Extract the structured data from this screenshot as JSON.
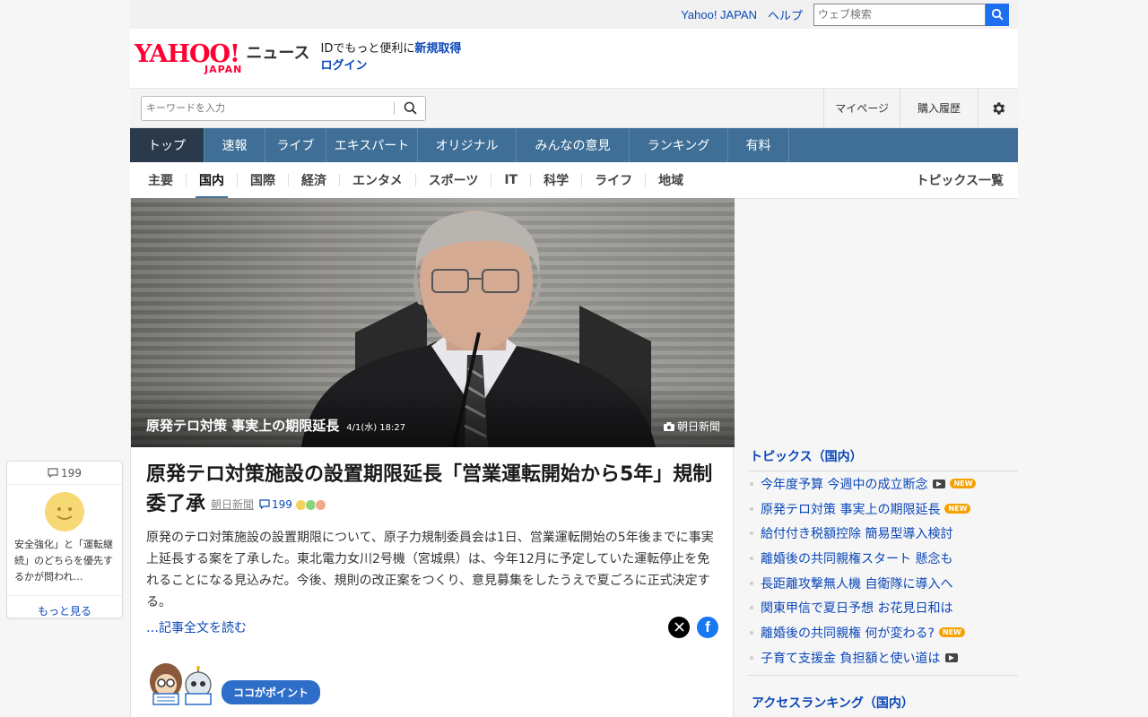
{
  "topbar": {
    "yahoo_link": "Yahoo! JAPAN",
    "help_link": "ヘルプ",
    "search_placeholder": "ウェブ検索"
  },
  "header": {
    "logo_text": "YAHOO!",
    "logo_sub": "JAPAN",
    "service": "ニュース",
    "id_prompt": "IDでもっと便利に",
    "signup": "新規取得",
    "login": "ログイン"
  },
  "search": {
    "placeholder": "キーワードを入力"
  },
  "user_links": {
    "mypage": "マイページ",
    "history": "購入履歴"
  },
  "nav": {
    "items": [
      {
        "label": "トップ",
        "w": 83
      },
      {
        "label": "速報",
        "w": 68
      },
      {
        "label": "ライブ",
        "w": 68
      },
      {
        "label": "エキスパート",
        "w": 102
      },
      {
        "label": "オリジナル",
        "w": 110
      },
      {
        "label": "みんなの意見",
        "w": 126
      },
      {
        "label": "ランキング",
        "w": 110
      },
      {
        "label": "有料",
        "w": 68
      }
    ]
  },
  "subnav": {
    "items": [
      "主要",
      "国内",
      "国際",
      "経済",
      "エンタメ",
      "スポーツ",
      "IT",
      "科学",
      "ライフ",
      "地域"
    ],
    "active": "国内",
    "all_topics": "トピックス一覧"
  },
  "hero": {
    "caption": "原発テロ対策 事実上の期限延長",
    "time": "4/1(水) 18:27",
    "source": "朝日新聞"
  },
  "article": {
    "title": "原発テロ対策施設の設置期限延長「営業運転開始から5年」規制委了承",
    "source": "朝日新聞",
    "comments": "199",
    "body": "原発のテロ対策施設の設置期限について、原子力規制委員会は1日、営業運転開始の5年後までに事実上延長する案を了承した。東北電力女川2号機（宮城県）は、今年12月に予定していた運転停止を免れることになる見込みだ。今後、規則の改正案をつくり、意見募集をしたうえで夏ごろに正式決定する。",
    "read_more": "…記事全文を読む",
    "point_label": "ココがポイント"
  },
  "topics": {
    "title": "トピックス（国内）",
    "items": [
      {
        "text": "今年度予算 今週中の成立断念",
        "video": true,
        "new": true
      },
      {
        "text": "原発テロ対策 事実上の期限延長",
        "video": false,
        "new": true
      },
      {
        "text": "給付付き税額控除 簡易型導入検討",
        "video": false,
        "new": false
      },
      {
        "text": "離婚後の共同親権スタート 懸念も",
        "video": false,
        "new": false
      },
      {
        "text": "長距離攻撃無人機 自衛隊に導入へ",
        "video": false,
        "new": false
      },
      {
        "text": "関東甲信で夏日予想 お花見日和は",
        "video": false,
        "new": false
      },
      {
        "text": "離婚後の共同親権 何が変わる?",
        "video": false,
        "new": true
      },
      {
        "text": "子育て支援金 負担額と使い道は",
        "video": true,
        "new": false
      }
    ],
    "new_label": "NEW"
  },
  "ranking": {
    "title": "アクセスランキング（国内）"
  },
  "comment_card": {
    "count": "199",
    "text": "安全強化」と「運転継続」のどちらを優先するかが問われ…",
    "more": "もっと見る"
  },
  "colors": {
    "accent": "#3f6f96",
    "link": "#0b47b8",
    "brand": "#ff0033",
    "new_badge": "#f5a100"
  }
}
